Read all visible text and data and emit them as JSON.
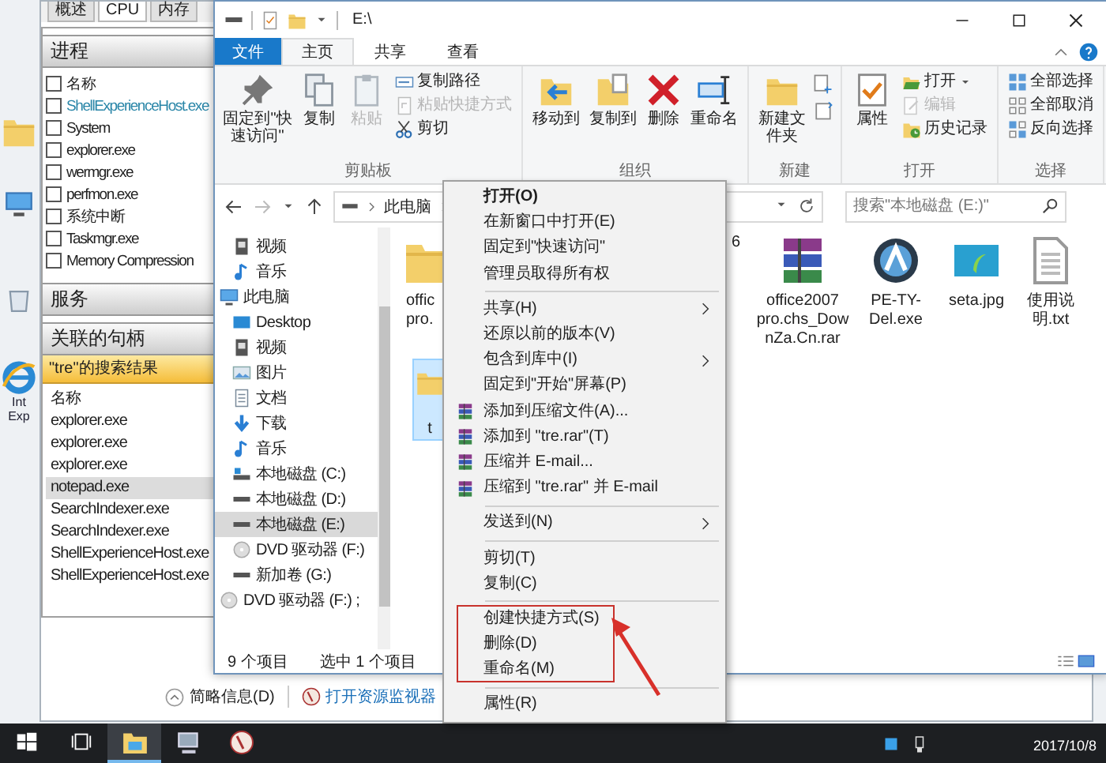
{
  "desktop": {
    "icon_label_lines": [
      "Int",
      "Exp"
    ]
  },
  "task_manager": {
    "tabs": [
      {
        "label": "概述",
        "selected": false
      },
      {
        "label": "CPU",
        "selected": true
      },
      {
        "label": "内存",
        "selected": false
      }
    ],
    "process_panel": {
      "title": "进程",
      "items": [
        {
          "label": "名称",
          "checked": false,
          "highlighted": false
        },
        {
          "label": "ShellExperienceHost.exe",
          "checked": false,
          "highlighted": true
        },
        {
          "label": "System",
          "checked": false,
          "highlighted": false
        },
        {
          "label": "explorer.exe",
          "checked": false,
          "highlighted": false
        },
        {
          "label": "wermgr.exe",
          "checked": false,
          "highlighted": false
        },
        {
          "label": "perfmon.exe",
          "checked": false,
          "highlighted": false
        },
        {
          "label": "系统中断",
          "checked": false,
          "highlighted": false
        },
        {
          "label": "Taskmgr.exe",
          "checked": false,
          "highlighted": false
        },
        {
          "label": "Memory Compression",
          "checked": false,
          "highlighted": false
        }
      ]
    },
    "services_panel": {
      "title": "服务"
    },
    "handles_panel": {
      "title": "关联的句柄",
      "search_banner": "\"tre\"的搜索结果",
      "items": [
        {
          "label": "名称",
          "selected": false
        },
        {
          "label": "explorer.exe",
          "selected": false
        },
        {
          "label": "explorer.exe",
          "selected": false
        },
        {
          "label": "explorer.exe",
          "selected": false
        },
        {
          "label": "notepad.exe",
          "selected": true
        },
        {
          "label": "SearchIndexer.exe",
          "selected": false
        },
        {
          "label": "SearchIndexer.exe",
          "selected": false
        },
        {
          "label": "ShellExperienceHost.exe",
          "selected": false
        },
        {
          "label": "ShellExperienceHost.exe",
          "selected": false
        }
      ]
    },
    "footer": {
      "details_button": "简略信息(D)",
      "monitor_link": "打开资源监视器"
    }
  },
  "explorer": {
    "title": "E:\\",
    "file_tab": "文件",
    "tabs": [
      {
        "label": "主页",
        "selected": true
      },
      {
        "label": "共享",
        "selected": false
      },
      {
        "label": "查看",
        "selected": false
      }
    ],
    "ribbon_groups": [
      {
        "label": "剪贴板",
        "commands": [
          {
            "label": "固定到\"快速访问\"",
            "kind": "large",
            "disabled": false
          },
          {
            "label": "复制",
            "kind": "large",
            "disabled": false
          },
          {
            "label": "粘贴",
            "kind": "large",
            "disabled": true
          },
          {
            "label": "复制路径",
            "kind": "small",
            "disabled": false
          },
          {
            "label": "粘贴快捷方式",
            "kind": "small",
            "disabled": true
          },
          {
            "label": "剪切",
            "kind": "small",
            "disabled": false
          }
        ]
      },
      {
        "label": "组织",
        "commands": [
          {
            "label": "移动到",
            "kind": "large",
            "disabled": false
          },
          {
            "label": "复制到",
            "kind": "large",
            "disabled": false
          },
          {
            "label": "删除",
            "kind": "large",
            "disabled": false
          },
          {
            "label": "重命名",
            "kind": "large",
            "disabled": false
          }
        ]
      },
      {
        "label": "新建",
        "commands": [
          {
            "label": "新建文件夹",
            "kind": "large",
            "disabled": false
          }
        ]
      },
      {
        "label": "打开",
        "commands": [
          {
            "label": "属性",
            "kind": "large",
            "disabled": false
          },
          {
            "label": "打开",
            "kind": "small-menu",
            "disabled": false
          },
          {
            "label": "编辑",
            "kind": "small",
            "disabled": true
          },
          {
            "label": "历史记录",
            "kind": "small",
            "disabled": false
          }
        ]
      },
      {
        "label": "选择",
        "commands": [
          {
            "label": "全部选择",
            "kind": "small",
            "disabled": false
          },
          {
            "label": "全部取消",
            "kind": "small",
            "disabled": false
          },
          {
            "label": "反向选择",
            "kind": "small",
            "disabled": false
          }
        ]
      }
    ],
    "breadcrumb": [
      "此电脑"
    ],
    "search": {
      "placeholder": "搜索\"本地磁盘 (E:)\""
    },
    "nav": {
      "quick_items": [
        {
          "label": "视频",
          "kind": "video",
          "selected": false
        },
        {
          "label": "音乐",
          "kind": "music",
          "selected": false
        }
      ],
      "tree": [
        {
          "label": "此电脑",
          "kind": "pc",
          "selected": false,
          "children": [
            {
              "label": "Desktop",
              "kind": "desktop",
              "selected": false
            },
            {
              "label": "视频",
              "kind": "video",
              "selected": false
            },
            {
              "label": "图片",
              "kind": "pictures",
              "selected": false
            },
            {
              "label": "文档",
              "kind": "documents",
              "selected": false
            },
            {
              "label": "下载",
              "kind": "download",
              "selected": false
            },
            {
              "label": "音乐",
              "kind": "music",
              "selected": false
            },
            {
              "label": "本地磁盘 (C:)",
              "kind": "system-disk",
              "selected": false
            },
            {
              "label": "本地磁盘 (D:)",
              "kind": "disk",
              "selected": false
            },
            {
              "label": "本地磁盘 (E:)",
              "kind": "disk",
              "selected": true
            },
            {
              "label": "DVD 驱动器 (F:)",
              "kind": "dvd",
              "selected": false
            },
            {
              "label": "新加卷 (G:)",
              "kind": "disk",
              "selected": false
            }
          ]
        },
        {
          "label": "DVD 驱动器 (F:) ;",
          "kind": "dvd",
          "selected": false
        }
      ]
    },
    "files": [
      {
        "label": "offic pro.",
        "kind": "folder"
      },
      {
        "label": "6",
        "kind": "label-only"
      },
      {
        "label": "office2007 pro.chs_DownZa.Cn.rar",
        "kind": "archive"
      },
      {
        "label": "PE-TY-Del.exe",
        "kind": "app"
      },
      {
        "label": "seta.jpg",
        "kind": "image"
      },
      {
        "label": "使用说明.txt",
        "kind": "text"
      }
    ],
    "selected_file": {
      "label": "t",
      "selected": true
    },
    "status": [
      "9 个项目",
      "选中 1 个项目"
    ]
  },
  "context_menu": [
    {
      "label": "打开(O)",
      "kind": "default"
    },
    {
      "label": "在新窗口中打开(E)",
      "kind": "plain"
    },
    {
      "label": "固定到\"快速访问\"",
      "kind": "plain"
    },
    {
      "label": "管理员取得所有权",
      "kind": "plain"
    },
    {
      "kind": "separator"
    },
    {
      "label": "共享(H)",
      "kind": "submenu"
    },
    {
      "label": "还原以前的版本(V)",
      "kind": "plain"
    },
    {
      "label": "包含到库中(I)",
      "kind": "submenu"
    },
    {
      "label": "固定到\"开始\"屏幕(P)",
      "kind": "plain"
    },
    {
      "label": "添加到压缩文件(A)...",
      "kind": "archive"
    },
    {
      "label": "添加到 \"tre.rar\"(T)",
      "kind": "archive"
    },
    {
      "label": "压缩并 E-mail...",
      "kind": "archive"
    },
    {
      "label": "压缩到 \"tre.rar\" 并 E-mail",
      "kind": "archive"
    },
    {
      "kind": "separator"
    },
    {
      "label": "发送到(N)",
      "kind": "submenu"
    },
    {
      "kind": "separator"
    },
    {
      "label": "剪切(T)",
      "kind": "plain"
    },
    {
      "label": "复制(C)",
      "kind": "plain"
    },
    {
      "kind": "separator"
    },
    {
      "label": "创建快捷方式(S)",
      "kind": "plain"
    },
    {
      "label": "删除(D)",
      "kind": "plain"
    },
    {
      "label": "重命名(M)",
      "kind": "plain"
    },
    {
      "kind": "separator"
    },
    {
      "label": "属性(R)",
      "kind": "plain"
    }
  ],
  "taskbar": {
    "clock": "2017/10/8"
  }
}
